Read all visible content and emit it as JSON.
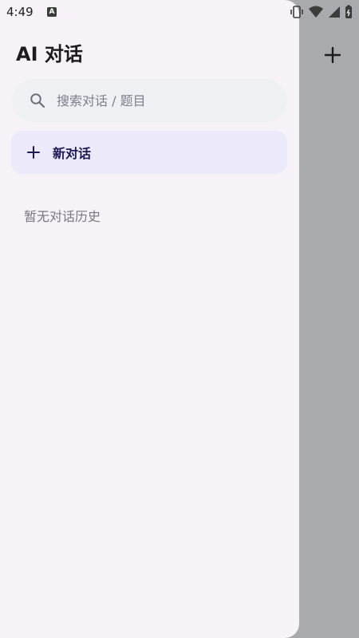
{
  "status_bar": {
    "time": "4:49",
    "notification_icon": "A",
    "icons": [
      "vibrate-icon",
      "wifi-icon",
      "signal-icon",
      "battery-icon"
    ]
  },
  "drawer": {
    "title": "AI 对话",
    "search": {
      "placeholder": "搜索对话 / 题目",
      "value": ""
    },
    "new_chat_label": "新对话",
    "empty_text": "暂无对话历史"
  },
  "background": {
    "add_icon": "plus-icon"
  },
  "colors": {
    "drawer_bg": "#f7f2f8",
    "scrim": "#a9aaad",
    "search_bg": "#eef0f4",
    "new_chat_bg": "#ece9fb",
    "new_chat_text": "#1c1a55"
  }
}
